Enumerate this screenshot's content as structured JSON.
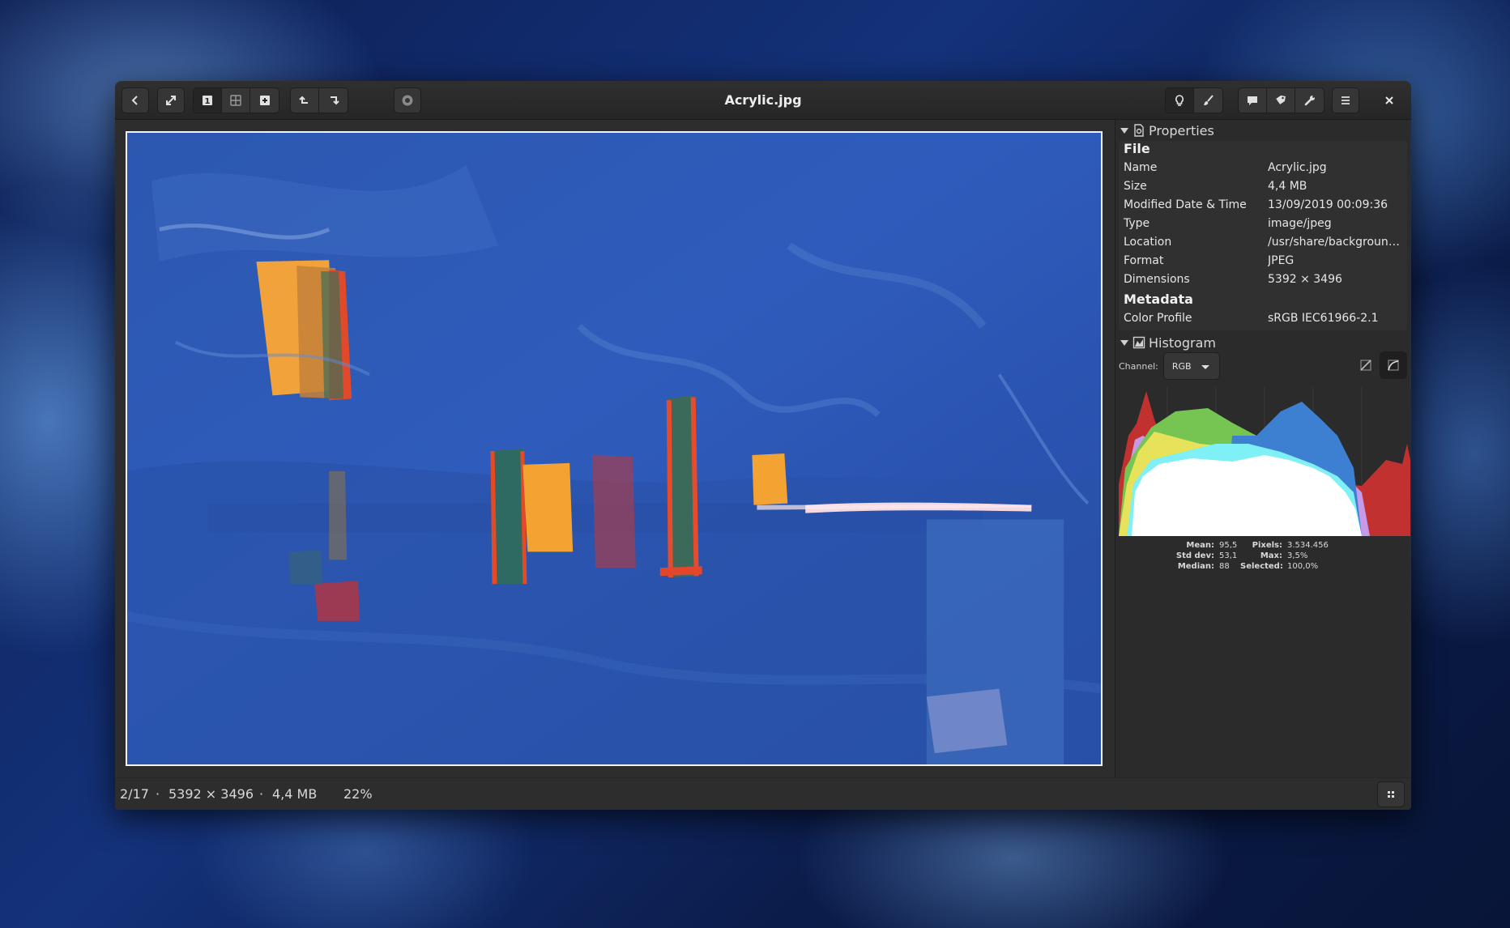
{
  "window": {
    "title": "Acrylic.jpg"
  },
  "toolbar": {
    "back": "chevron-left-icon",
    "fullscreen": "expand-icon",
    "view_modes": [
      "single-view-icon",
      "grid-view-icon",
      "add-icon"
    ],
    "rotate": [
      "rotate-left-icon",
      "rotate-right-icon"
    ],
    "slideshow": "slideshow-icon",
    "right_group_1": [
      "bulb-icon",
      "brush-icon"
    ],
    "right_group_2": [
      "comment-icon",
      "tag-icon",
      "wrench-icon"
    ],
    "menu": "menu-icon",
    "close": "close-icon"
  },
  "properties": {
    "header": "Properties",
    "file_heading": "File",
    "file_rows": [
      {
        "key": "Name",
        "value": "Acrylic.jpg"
      },
      {
        "key": "Size",
        "value": "4,4  MB"
      },
      {
        "key": "Modified Date & Time",
        "value": "13/09/2019 00:09:36"
      },
      {
        "key": "Type",
        "value": "image/jpeg"
      },
      {
        "key": "Location",
        "value": "/usr/share/background..."
      },
      {
        "key": "Format",
        "value": "JPEG"
      },
      {
        "key": "Dimensions",
        "value": "5392 × 3496"
      }
    ],
    "metadata_heading": "Metadata",
    "metadata_rows": [
      {
        "key": "Color Profile",
        "value": "sRGB IEC61966-2.1"
      }
    ]
  },
  "histogram": {
    "header": "Histogram",
    "channel_label": "Channel:",
    "channel_value": "RGB",
    "mode_buttons": [
      "linear-scale-icon",
      "log-scale-icon"
    ],
    "active_mode": "log-scale-icon",
    "colors": {
      "red": "#c0312f",
      "green": "#76c552",
      "blue": "#3d7fd1",
      "yellow": "#e6e35a",
      "cyan": "#7ff0f5",
      "magenta": "#c59ae8",
      "white": "#ffffff"
    },
    "stats": {
      "mean_label": "Mean:",
      "mean": "95,5",
      "stddev_label": "Std dev:",
      "stddev": "53,1",
      "median_label": "Median:",
      "median": "88",
      "pixels_label": "Pixels:",
      "pixels": "3.534.456",
      "max_label": "Max:",
      "max": "3,5%",
      "selected_label": "Selected:",
      "selected": "100,0%"
    }
  },
  "status": {
    "position": "2/17",
    "sep1": "·",
    "dimensions": "5392 × 3496",
    "sep2": "·",
    "size": "4,4  MB",
    "zoom": "22%"
  }
}
